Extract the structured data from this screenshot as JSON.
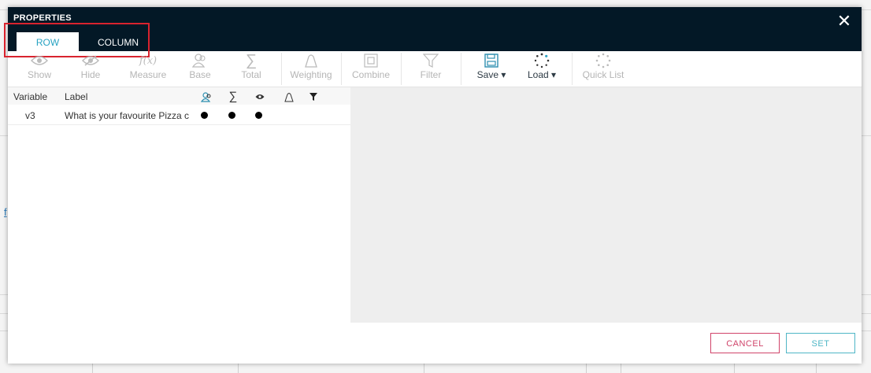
{
  "modal": {
    "title": "PROPERTIES",
    "close_glyph": "✕"
  },
  "tabs": [
    {
      "label": "ROW",
      "active": true
    },
    {
      "label": "COLUMN",
      "active": false
    }
  ],
  "toolbar": {
    "show": "Show",
    "hide": "Hide",
    "measure": "Measure",
    "measure_glyph": "f(x)",
    "base": "Base",
    "total": "Total",
    "total_glyph": "∑",
    "weighting": "Weighting",
    "combine": "Combine",
    "filter": "Filter",
    "save": "Save ▾",
    "load": "Load ▾",
    "quick_list": "Quick List"
  },
  "table": {
    "headers": {
      "variable": "Variable",
      "label": "Label",
      "sum_glyph": "∑"
    },
    "rows": [
      {
        "variable": "v3",
        "label": "What is your favourite Pizza c",
        "base": true,
        "total": true,
        "show": true
      }
    ]
  },
  "background": {
    "link_text": "f"
  },
  "footer": {
    "cancel": "CANCEL",
    "set": "SET"
  },
  "colors": {
    "header_bg": "#031826",
    "tab_active_text": "#29a3c2",
    "cancel": "#d0446a",
    "set": "#4fb6c6",
    "highlight": "#d9232e"
  }
}
